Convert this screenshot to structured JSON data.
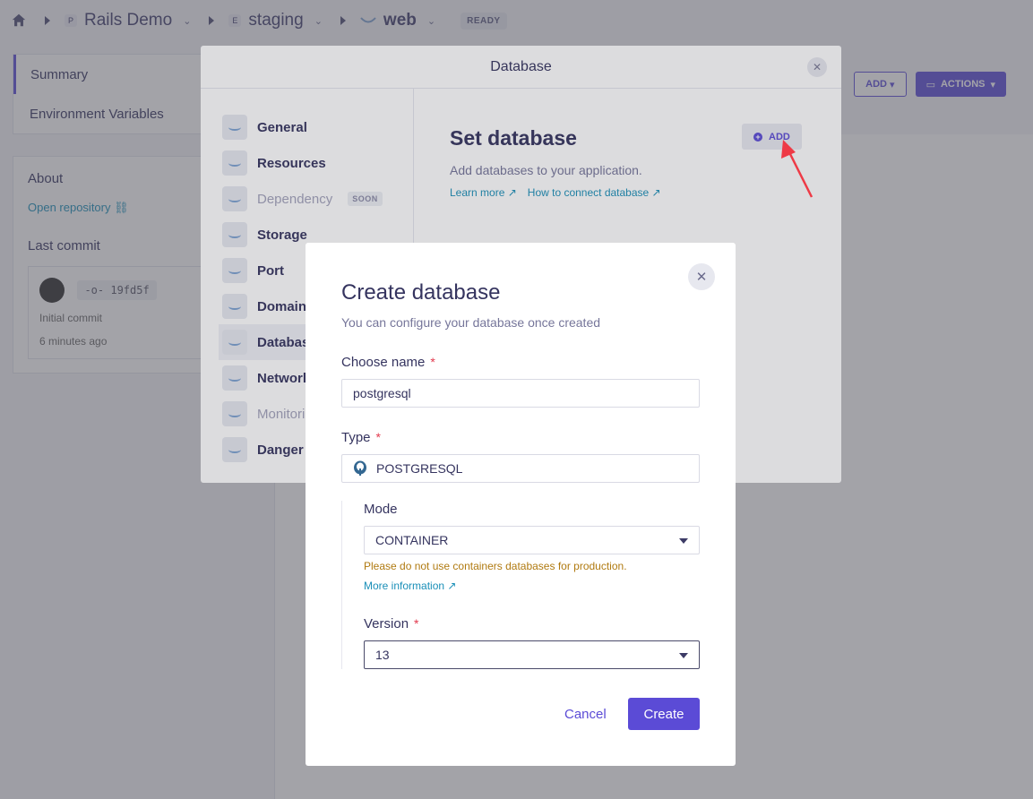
{
  "breadcrumb": {
    "project_badge": "P",
    "project": "Rails Demo",
    "env_badge": "E",
    "environment": "staging",
    "app": "web",
    "status": "READY"
  },
  "leftnav": {
    "items": [
      {
        "label": "Summary"
      },
      {
        "label": "Environment Variables"
      }
    ]
  },
  "about": {
    "title": "About",
    "repo_link": "Open repository",
    "last_commit_title": "Last commit",
    "commit_sha": "19fd5f",
    "commit_msg": "Initial commit",
    "commit_time": "6 minutes ago"
  },
  "header_buttons": {
    "add": "ADD",
    "actions": "ACTIONS"
  },
  "database_modal": {
    "title": "Database",
    "sidebar": [
      {
        "label": "General",
        "muted": false
      },
      {
        "label": "Resources",
        "muted": false
      },
      {
        "label": "Dependency",
        "muted": true,
        "badge": "SOON"
      },
      {
        "label": "Storage",
        "muted": false
      },
      {
        "label": "Port",
        "muted": false
      },
      {
        "label": "Domain",
        "muted": false
      },
      {
        "label": "Database",
        "muted": false,
        "active": true
      },
      {
        "label": "Network",
        "muted": false
      },
      {
        "label": "Monitoring",
        "muted": true
      },
      {
        "label": "Danger zone",
        "muted": false
      }
    ],
    "heading": "Set database",
    "description": "Add databases to your application.",
    "learn_more": "Learn more",
    "how_to": "How to connect database",
    "add_button": "ADD"
  },
  "create_modal": {
    "title": "Create database",
    "subtitle": "You can configure your database once created",
    "name_label": "Choose name",
    "name_value": "postgresql",
    "type_label": "Type",
    "type_value": "POSTGRESQL",
    "mode_label": "Mode",
    "mode_value": "CONTAINER",
    "warning": "Please do not use containers databases for production.",
    "more_info": "More information",
    "version_label": "Version",
    "version_value": "13",
    "cancel": "Cancel",
    "create": "Create",
    "required_mark": "*"
  },
  "colors": {
    "primary": "#5b4bd6",
    "link": "#1a8fb8",
    "warning": "#b07a10",
    "required": "#e23a4e"
  }
}
